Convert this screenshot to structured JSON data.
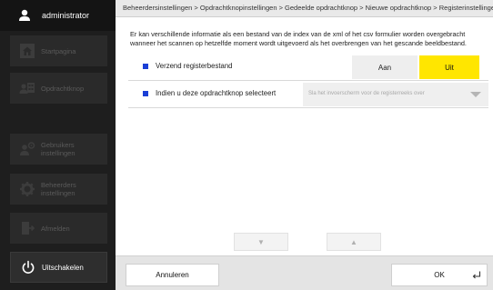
{
  "user": {
    "name": "administrator",
    "icon": "user-icon"
  },
  "sidebar": {
    "items": [
      {
        "label": "Startpagina",
        "icon": "home-icon"
      },
      {
        "label": "Opdrachtknop",
        "icon": "user-grid-icon"
      },
      {
        "label": "Gebruikers instellingen",
        "icon": "user-gear-icon"
      },
      {
        "label": "Beheerders instellingen",
        "icon": "gear-icon"
      },
      {
        "label": "Afmelden",
        "icon": "logout-icon"
      }
    ],
    "power": {
      "label": "Uitschakelen",
      "icon": "power-icon"
    }
  },
  "breadcrumb": "Beheerdersinstellingen > Opdrachtknopinstellingen > Gedeelde opdrachtknop > Nieuwe opdrachtknop > Registerinstellingen",
  "description": "Er kan verschillende informatie als een bestand van de index van de xml of het csv formulier worden overgebracht wanneer het scannen op hetzelfde moment wordt uitgevoerd als het overbrengen van het gescande beeldbestand.",
  "settings": {
    "register_file": {
      "label": "Verzend registerbestand",
      "on_label": "Aan",
      "off_label": "Uit",
      "selected": "Uit"
    },
    "when_selected": {
      "label": "Indien u deze opdrachtknop selecteert",
      "value": "Sla het invoerscherm voor de registerreeks over"
    }
  },
  "scroll": {
    "down_icon": "triangle-down-icon",
    "up_icon": "triangle-up-icon",
    "down": "▼",
    "up": "▲"
  },
  "footer": {
    "cancel_label": "Annuleren",
    "ok_label": "OK",
    "ok_icon": "enter-icon"
  },
  "colors": {
    "accent_yellow": "#ffe600",
    "bullet_blue": "#1a3fd6",
    "sidebar_bg": "#1e1e1e"
  }
}
